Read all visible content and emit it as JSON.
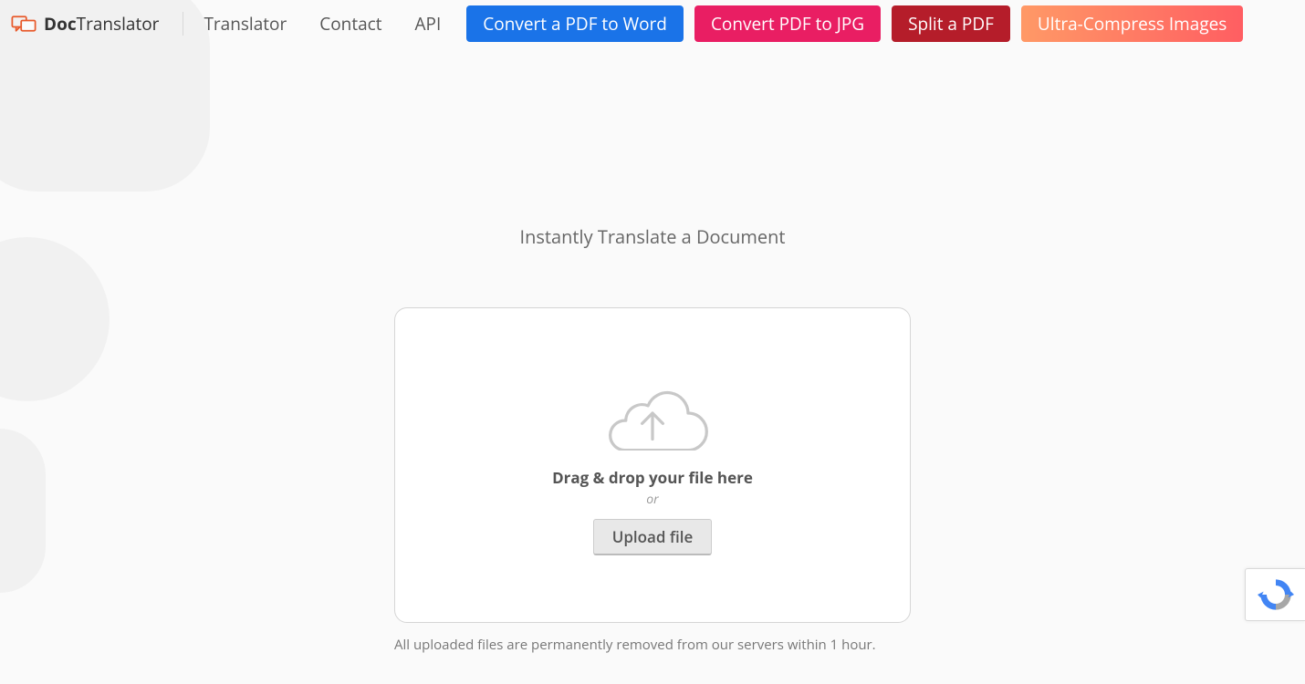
{
  "brand": {
    "bold": "Doc",
    "light": "Translator"
  },
  "nav": {
    "translator": "Translator",
    "contact": "Contact",
    "api": "API"
  },
  "cta": {
    "pdf_to_word": "Convert a PDF to Word",
    "pdf_to_jpg": "Convert PDF to JPG",
    "split_pdf": "Split a PDF",
    "ultra_compress": "Ultra-Compress Images"
  },
  "main": {
    "title": "Instantly Translate a Document",
    "drop_title": "Drag & drop your file here",
    "drop_or": "or",
    "upload_label": "Upload file",
    "privacy": "All uploaded files are permanently removed from our servers within 1 hour."
  },
  "colors": {
    "blue": "#1a73e8",
    "pink": "#e91e63",
    "darkred": "#b51d2a",
    "orange_start": "#ff9966",
    "orange_end": "#ff5e62"
  }
}
